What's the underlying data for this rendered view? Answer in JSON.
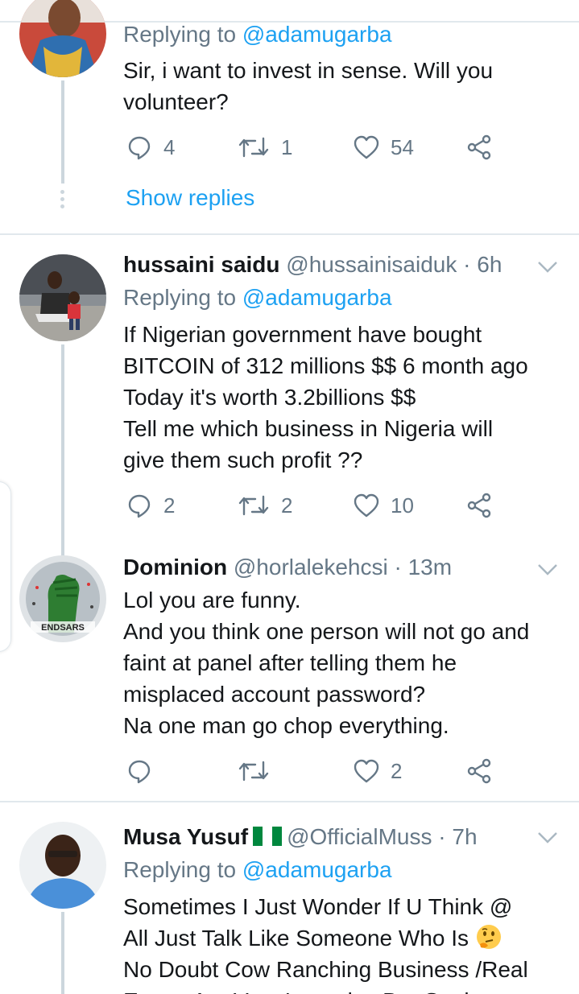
{
  "tweets": [
    {
      "replying_prefix": "Replying to ",
      "replying_to": "@adamugarba",
      "lines": [
        "Sir, i want to invest in sense. Will you",
        "volunteer?"
      ],
      "replies": "4",
      "retweets": "1",
      "likes": "54",
      "show_replies": "Show replies"
    },
    {
      "name": "hussaini saidu",
      "handle": "@hussainisaiduk",
      "time": "· 6h",
      "replying_prefix": "Replying to ",
      "replying_to": "@adamugarba",
      "lines": [
        "If Nigerian government have bought",
        "BITCOIN of 312 millions $$ 6 month ago",
        "Today it's worth 3.2billions $$",
        "Tell me which business in Nigeria will",
        "give them such profit ??"
      ],
      "replies": "2",
      "retweets": "2",
      "likes": "10"
    },
    {
      "name": "Dominion",
      "handle": "@horlalekehcsi",
      "time": "· 13m",
      "avatar_text": "ENDSARS",
      "lines": [
        "Lol you are funny.",
        "And you think one person will not go and",
        "faint at panel after telling them he",
        "misplaced account password?",
        "Na one man go chop everything."
      ],
      "replies": "",
      "retweets": "",
      "likes": "2"
    },
    {
      "name": "Musa Yusuf",
      "handle": "@OfficialMuss",
      "time": "· 7h",
      "replying_prefix": "Replying to ",
      "replying_to": "@adamugarba",
      "lines": [
        "Sometimes I Just Wonder If U Think @",
        "All Just Talk Like Someone Who Is",
        "No Doubt Cow Ranching Business /Real",
        "Estate Are Very Lucrative But Govimen"
      ]
    }
  ],
  "colors": {
    "link": "#1da1f2",
    "muted": "#657786",
    "text": "#14171a",
    "divider": "#e1e8ed",
    "thread": "#ccd6dd"
  },
  "icons": {
    "reply": "reply-icon",
    "retweet": "retweet-icon",
    "like": "heart-icon",
    "share": "share-icon",
    "more": "chevron-down-icon",
    "flag": "nigeria-flag-icon",
    "emoji": "thinking-face-emoji"
  }
}
